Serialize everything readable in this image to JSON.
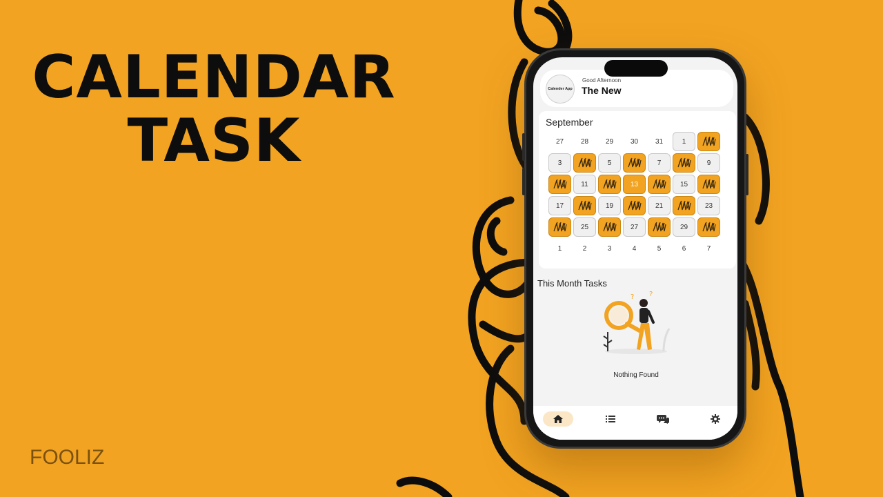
{
  "headline": {
    "line1": "CALENDAR",
    "line2": "TASK"
  },
  "brand": "FOOLIZ",
  "app": {
    "avatar_text": "Calender App",
    "greeting": "Good Afternoon",
    "user_name": "The New",
    "month": "September",
    "calendar": {
      "rows": [
        [
          {
            "t": "27",
            "s": "plain"
          },
          {
            "t": "28",
            "s": "plain"
          },
          {
            "t": "29",
            "s": "plain"
          },
          {
            "t": "30",
            "s": "plain"
          },
          {
            "t": "31",
            "s": "plain"
          },
          {
            "t": "1",
            "s": "box"
          },
          {
            "t": "",
            "s": "task"
          }
        ],
        [
          {
            "t": "3",
            "s": "box"
          },
          {
            "t": "",
            "s": "task"
          },
          {
            "t": "5",
            "s": "box"
          },
          {
            "t": "",
            "s": "task"
          },
          {
            "t": "7",
            "s": "box"
          },
          {
            "t": "",
            "s": "task"
          },
          {
            "t": "9",
            "s": "box"
          }
        ],
        [
          {
            "t": "",
            "s": "task"
          },
          {
            "t": "11",
            "s": "box"
          },
          {
            "t": "",
            "s": "task"
          },
          {
            "t": "13",
            "s": "today"
          },
          {
            "t": "",
            "s": "task"
          },
          {
            "t": "15",
            "s": "box"
          },
          {
            "t": "",
            "s": "task"
          }
        ],
        [
          {
            "t": "17",
            "s": "box"
          },
          {
            "t": "",
            "s": "task"
          },
          {
            "t": "19",
            "s": "box"
          },
          {
            "t": "",
            "s": "task"
          },
          {
            "t": "21",
            "s": "box"
          },
          {
            "t": "",
            "s": "task"
          },
          {
            "t": "23",
            "s": "box"
          }
        ],
        [
          {
            "t": "",
            "s": "task"
          },
          {
            "t": "25",
            "s": "box"
          },
          {
            "t": "",
            "s": "task"
          },
          {
            "t": "27",
            "s": "box"
          },
          {
            "t": "",
            "s": "task"
          },
          {
            "t": "29",
            "s": "box"
          },
          {
            "t": "",
            "s": "task"
          }
        ],
        [
          {
            "t": "1",
            "s": "plain"
          },
          {
            "t": "2",
            "s": "plain"
          },
          {
            "t": "3",
            "s": "plain"
          },
          {
            "t": "4",
            "s": "plain"
          },
          {
            "t": "5",
            "s": "plain"
          },
          {
            "t": "6",
            "s": "plain"
          },
          {
            "t": "7",
            "s": "plain"
          }
        ]
      ]
    },
    "section_title": "This Month Tasks",
    "empty_text": "Nothing Found",
    "tabs": [
      {
        "icon": "home-icon",
        "active": true
      },
      {
        "icon": "list-icon",
        "active": false
      },
      {
        "icon": "chat-icon",
        "active": false
      },
      {
        "icon": "gear-icon",
        "active": false
      }
    ],
    "colors": {
      "accent": "#f2a321",
      "background": "#f2a321",
      "ink": "#0d0d0d"
    }
  }
}
